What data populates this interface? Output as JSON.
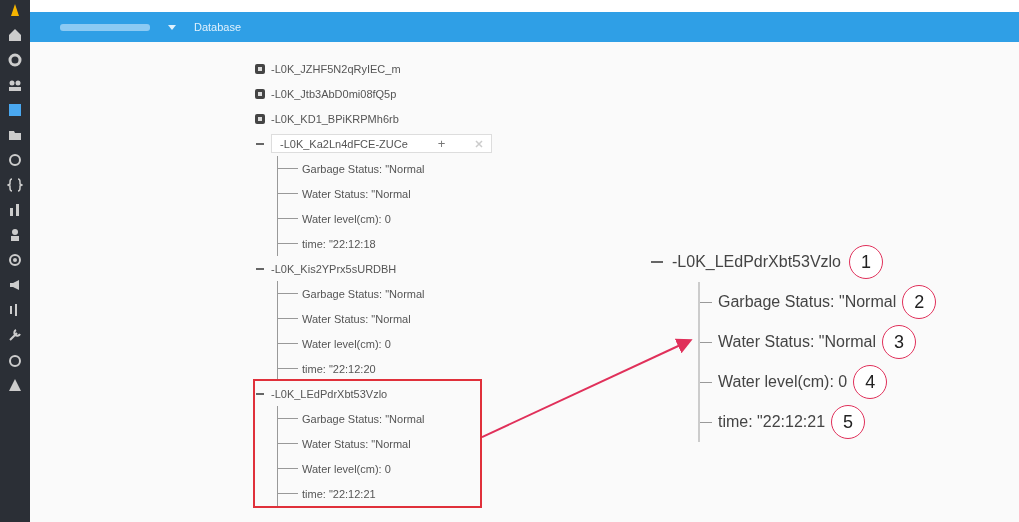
{
  "top_bar": {
    "section": "Database"
  },
  "tree": {
    "nodes": [
      {
        "key": "-L0K_JZHF5N2qRyIEC_m",
        "expanded": false,
        "highlighted": false,
        "hovered": false
      },
      {
        "key": "-L0K_Jtb3AbD0mi08fQ5p",
        "expanded": false,
        "highlighted": false,
        "hovered": false
      },
      {
        "key": "-L0K_KD1_BPiKRPMh6rb",
        "expanded": false,
        "highlighted": false,
        "hovered": false
      },
      {
        "key": "-L0K_Ka2Ln4dFCE-ZUCe",
        "expanded": true,
        "highlighted": false,
        "hovered": true,
        "add_label": "+",
        "children": [
          {
            "label": "Garbage Status:",
            "value": "\"Normal"
          },
          {
            "label": "Water Status:",
            "value": "\"Normal"
          },
          {
            "label": "Water level(cm):",
            "value": "0"
          },
          {
            "label": "time:",
            "value": "\"22:12:18"
          }
        ]
      },
      {
        "key": "-L0K_Kis2YPrx5sURDBH",
        "expanded": true,
        "highlighted": false,
        "hovered": false,
        "children": [
          {
            "label": "Garbage Status:",
            "value": "\"Normal"
          },
          {
            "label": "Water Status:",
            "value": "\"Normal"
          },
          {
            "label": "Water level(cm):",
            "value": "0"
          },
          {
            "label": "time:",
            "value": "\"22:12:20"
          }
        ]
      },
      {
        "key": "-L0K_LEdPdrXbt53Vzlo",
        "expanded": true,
        "highlighted": true,
        "hovered": false,
        "children": [
          {
            "label": "Garbage Status:",
            "value": "\"Normal"
          },
          {
            "label": "Water Status:",
            "value": "\"Normal"
          },
          {
            "label": "Water level(cm):",
            "value": "0"
          },
          {
            "label": "time:",
            "value": "\"22:12:21"
          }
        ]
      }
    ]
  },
  "callout": {
    "key": "-L0K_LEdPdrXbt53Vzlo",
    "marker": "1",
    "children": [
      {
        "label": "Garbage Status:",
        "value": "\"Normal",
        "marker": "2"
      },
      {
        "label": "Water Status:",
        "value": "\"Normal",
        "marker": "3"
      },
      {
        "label": "Water level(cm):",
        "value": "0",
        "marker": "4"
      },
      {
        "label": "time:",
        "value": "\"22:12:21",
        "marker": "5"
      }
    ]
  }
}
